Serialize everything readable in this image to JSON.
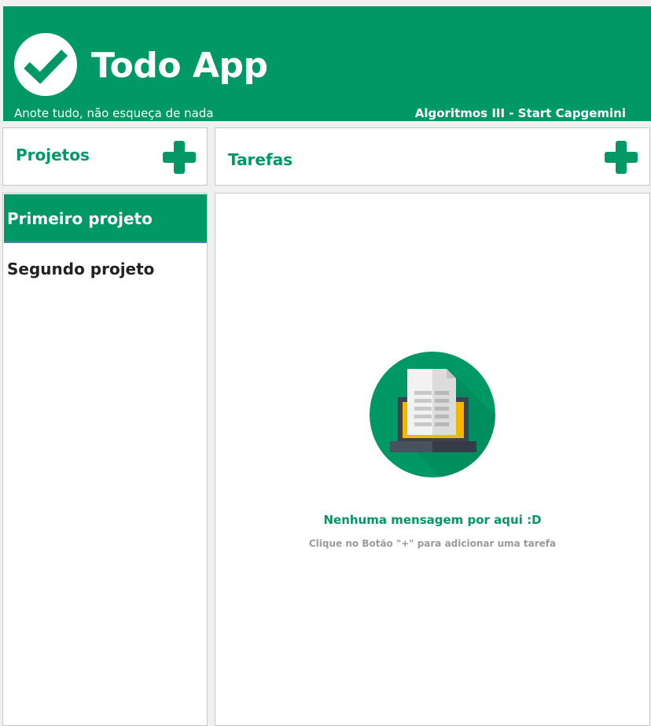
{
  "colors": {
    "brand": "#009966",
    "selected_border": "#4a7fb0",
    "hint_text": "#9a9a9a"
  },
  "header": {
    "logo_icon": "checkmark-circle-icon",
    "title": "Todo App",
    "subtitle": "Anote tudo, não esqueça de nada",
    "course": "Algoritmos III - Start Capgemini"
  },
  "projects": {
    "title": "Projetos",
    "add_icon": "plus-icon",
    "items": [
      {
        "label": "Primeiro projeto",
        "selected": true
      },
      {
        "label": "Segundo projeto",
        "selected": false
      }
    ]
  },
  "tasks": {
    "title": "Tarefas",
    "add_icon": "plus-icon",
    "empty_state": {
      "illustration_icon": "laptop-document-icon",
      "title": "Nenhuma mensagem por aqui :D",
      "hint": "Clique no Botão \"+\" para adicionar uma tarefa"
    }
  }
}
